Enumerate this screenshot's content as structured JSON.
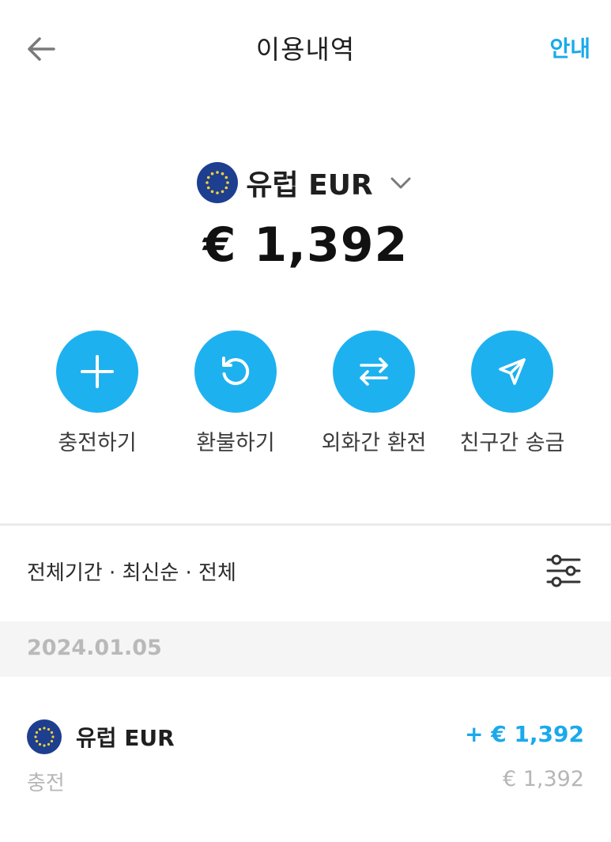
{
  "header": {
    "title": "이용내역",
    "guide_label": "안내"
  },
  "currency": {
    "name": "유럽 EUR",
    "balance": "€ 1,392",
    "flag_icon": "eu-flag-icon"
  },
  "actions": [
    {
      "label": "충전하기",
      "icon": "plus-icon"
    },
    {
      "label": "환불하기",
      "icon": "refund-icon"
    },
    {
      "label": "외화간 환전",
      "icon": "exchange-icon"
    },
    {
      "label": "친구간 송금",
      "icon": "send-icon"
    }
  ],
  "filter": {
    "summary": "전체기간 · 최신순 · 전체",
    "icon": "sliders-icon"
  },
  "history": [
    {
      "date": "2024.01.05",
      "items": [
        {
          "name": "유럽 EUR",
          "amount": "+ € 1,392",
          "type": "충전",
          "balance": "€ 1,392"
        }
      ]
    }
  ],
  "colors": {
    "accent": "#1eb1f0",
    "link": "#1aa9ec",
    "flag_blue": "#1e3f8f",
    "flag_star": "#f6d232",
    "muted": "#b6b6b6"
  }
}
